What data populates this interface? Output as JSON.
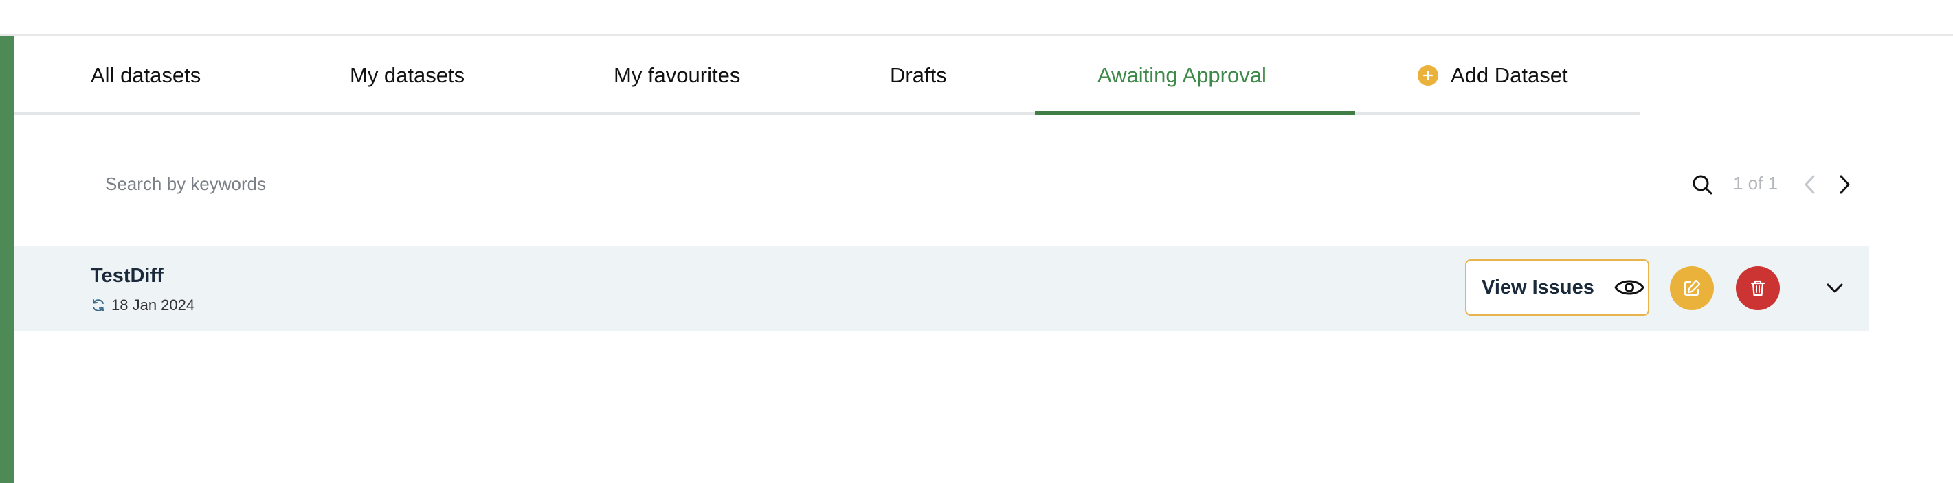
{
  "tabs": [
    {
      "label": "All datasets",
      "active": false
    },
    {
      "label": "My datasets",
      "active": false
    },
    {
      "label": "My favourites",
      "active": false
    },
    {
      "label": "Drafts",
      "active": false
    },
    {
      "label": "Awaiting Approval",
      "active": true
    },
    {
      "label": "Add Dataset",
      "icon": "plus-circle-icon",
      "active": false
    }
  ],
  "search": {
    "placeholder": "Search by keywords",
    "value": "",
    "icon": "search-icon"
  },
  "pagination": {
    "text": "1 of 1",
    "prev_icon": "chevron-left-icon",
    "next_icon": "chevron-right-icon"
  },
  "datasets": [
    {
      "title": "TestDiff",
      "date_icon": "refresh-icon",
      "date": "18 Jan 2024",
      "view_issues_label": "View Issues",
      "view_icon": "eye-icon",
      "edit_icon": "pencil-icon",
      "delete_icon": "trash-icon",
      "expand_icon": "chevron-down-icon"
    }
  ],
  "colors": {
    "accent_green": "#3f8a4a",
    "side_bar_green": "#4e8a55",
    "edit_yellow": "#eab23a",
    "delete_red": "#cc3333",
    "row_background": "#eef3f5"
  }
}
